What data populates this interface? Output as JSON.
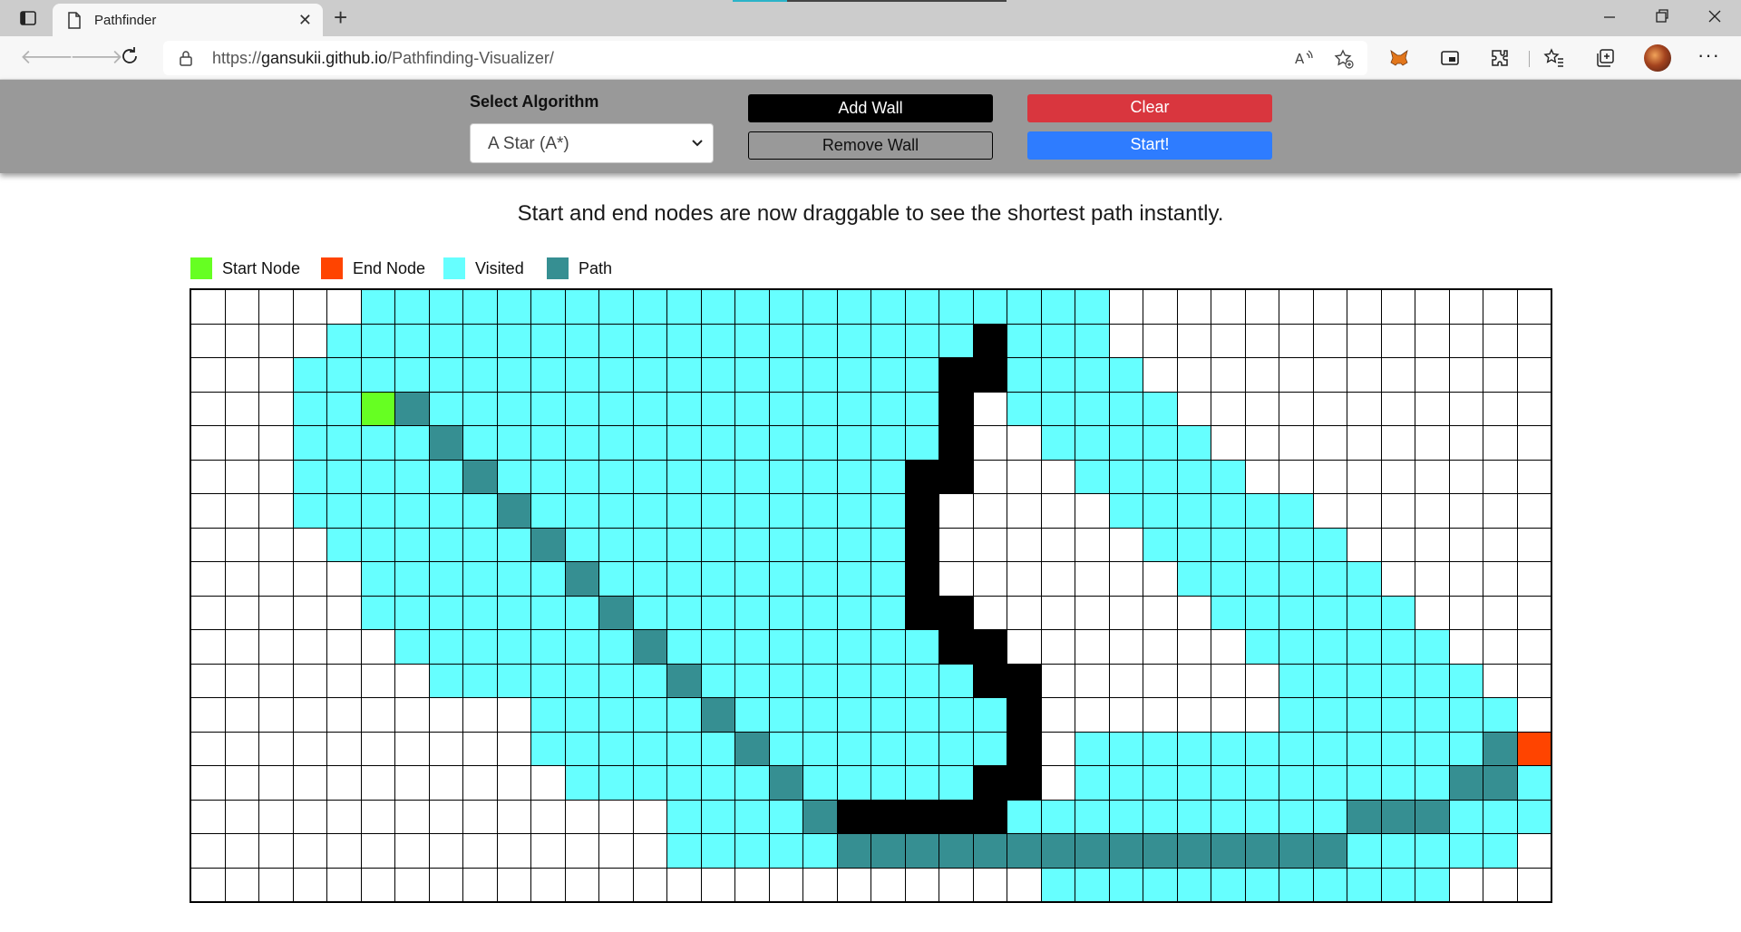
{
  "browser": {
    "tab_title": "Pathfinder",
    "url_prefix": "https://",
    "url_host": "gansukii.github.io",
    "url_path": "/Pathfinding-Visualizer/"
  },
  "navbar": {
    "select_label": "Select Algorithm",
    "select_value": "A Star (A*)",
    "add_wall": "Add Wall",
    "remove_wall": "Remove Wall",
    "clear": "Clear",
    "start": "Start!"
  },
  "info_text": "Start and end nodes are now draggable to see the shortest path instantly.",
  "legend": [
    {
      "label": "Start Node",
      "color": "#66ff22"
    },
    {
      "label": "End Node",
      "color": "#ff4400"
    },
    {
      "label": "Visited",
      "color": "#66ffff"
    },
    {
      "label": "Path",
      "color": "#368f92"
    }
  ],
  "grid": {
    "columns": 40,
    "key": {
      ".": "unvisited",
      "v": "visited",
      "p": "path",
      "w": "wall",
      "s": "start",
      "e": "end"
    },
    "rows": [
      ".....vvvvvvvvvvvvvvvvvvvvvv.............",
      "....vvvvvvvvvvvvvvvvvvvwvvv.............",
      "...vvvvvvvvvvvvvvvvvvvwwvvvv............",
      "...vvspvvvvvvvvvvvvvvvw.vvvvv...........",
      "...vvvvpvvvvvvvvvvvvvvw..vvvvv..........",
      "...vvvvvpvvvvvvvvvvvvww...vvvvv.........",
      "...vvvvvvpvvvvvvvvvvvw.....vvvvvv.......",
      "....vvvvvvpvvvvvvvvvvw......vvvvvv......",
      ".....vvvvvvpvvvvvvvvvw.......vvvvvv.....",
      ".....vvvvvvvpvvvvvvvvww.......vvvvvv....",
      "......vvvvvvvpvvvvvvvvww.......vvvvvv...",
      ".......vvvvvvvpvvvvvvvvww.......vvvvvv..",
      "..........vvvvvpvvvvvvvvw.......vvvvvvv.",
      "..........vvvvvvpvvvvvvvw.vvvvvvvvvvvvpe",
      "...........vvvvvvpvvvvvww.vvvvvvvvvvvppv",
      "..............vvvvpwwwwwvvvvvvvvvvpppvvv",
      "..............vvvvvpppppppppppppppvvvvv.",
      ".........................vvvvvvvvvvvv..."
    ]
  }
}
